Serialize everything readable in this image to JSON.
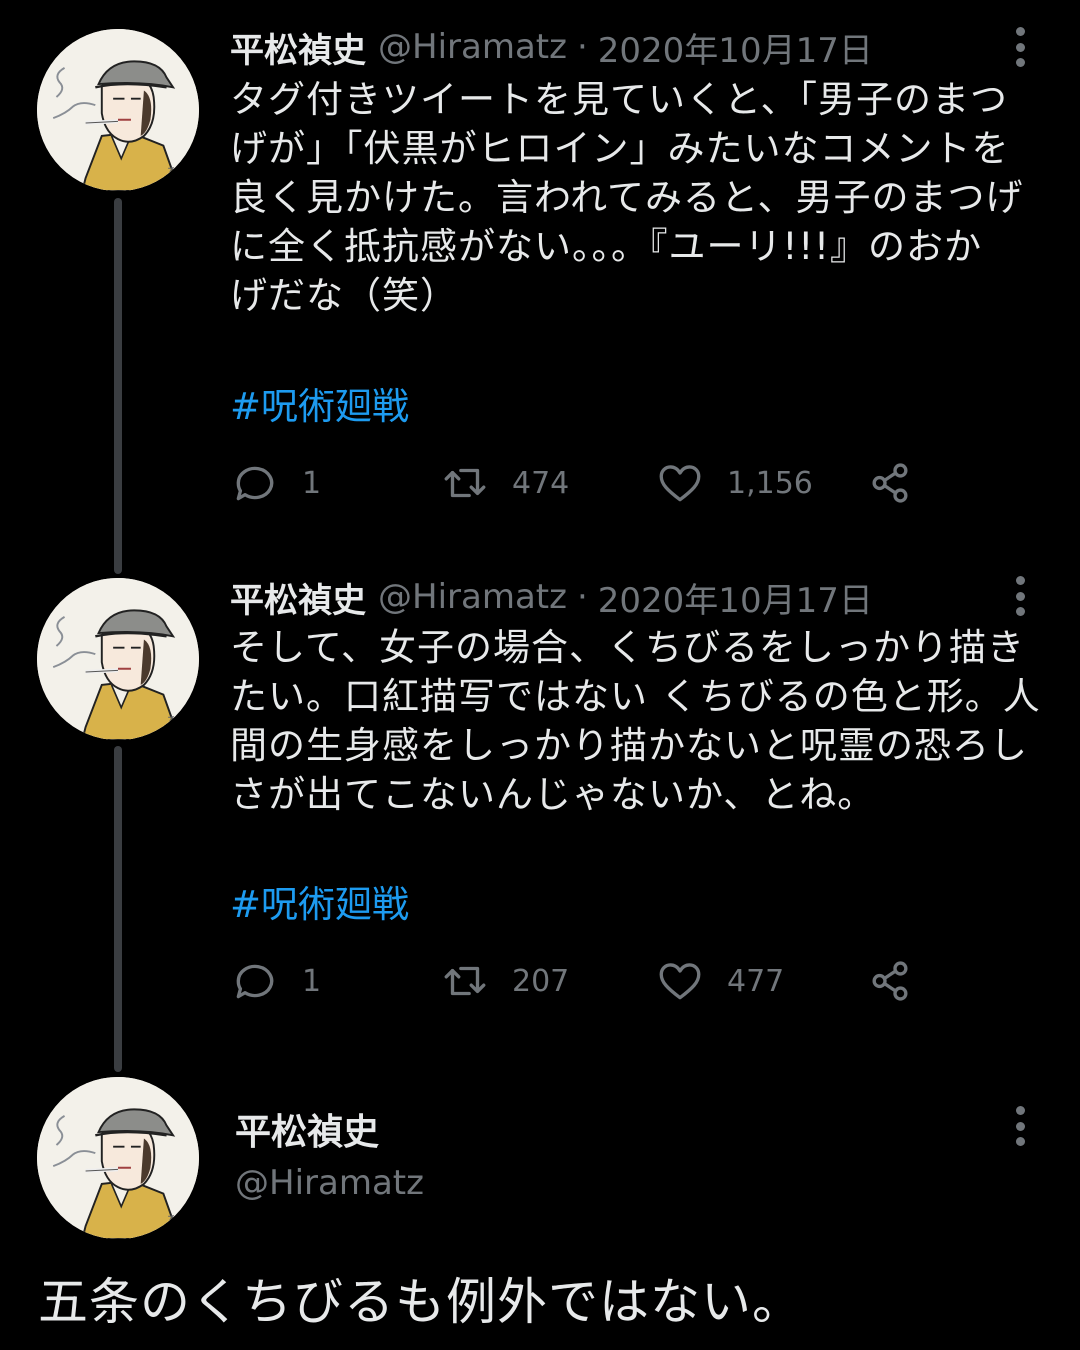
{
  "tweets": [
    {
      "name": "平松禎史",
      "handle": "@Hiramatz",
      "separator": "·",
      "date": "2020年10月17日",
      "lines": [
        "タグ付きツイートを見ていくと、「男子のまつ",
        "げが」「伏黒がヒロイン」みたいなコメントを",
        "良く見かけた。言われてみると、男子のまつげ",
        "に全く抵抗感がない。。。『ユーリ!!!』のおか",
        "げだな（笑）"
      ],
      "hashtag": "#呪術廻戦",
      "replies": "1",
      "retweets": "474",
      "likes": "1,156"
    },
    {
      "name": "平松禎史",
      "handle": "@Hiramatz",
      "separator": "·",
      "date": "2020年10月17日",
      "lines": [
        "そして、女子の場合、くちびるをしっかり描き",
        "たい。口紅描写ではない くちびるの色と形。人",
        "間の生身感をしっかり描かないと呪霊の恐ろし",
        "さが出てこないんじゃないか、とね。"
      ],
      "hashtag": "#呪術廻戦",
      "replies": "1",
      "retweets": "207",
      "likes": "477"
    }
  ],
  "main_tweet": {
    "name": "平松禎史",
    "handle": "@Hiramatz",
    "text": "五条のくちびるも例外ではない。"
  },
  "colors": {
    "background": "#000000",
    "text": "#e7e9ea",
    "muted": "#71767b",
    "link": "#1d9bf0",
    "thread_line": "#3a3d41"
  },
  "icons": [
    "reply-icon",
    "retweet-icon",
    "like-icon",
    "share-icon",
    "more-icon"
  ]
}
